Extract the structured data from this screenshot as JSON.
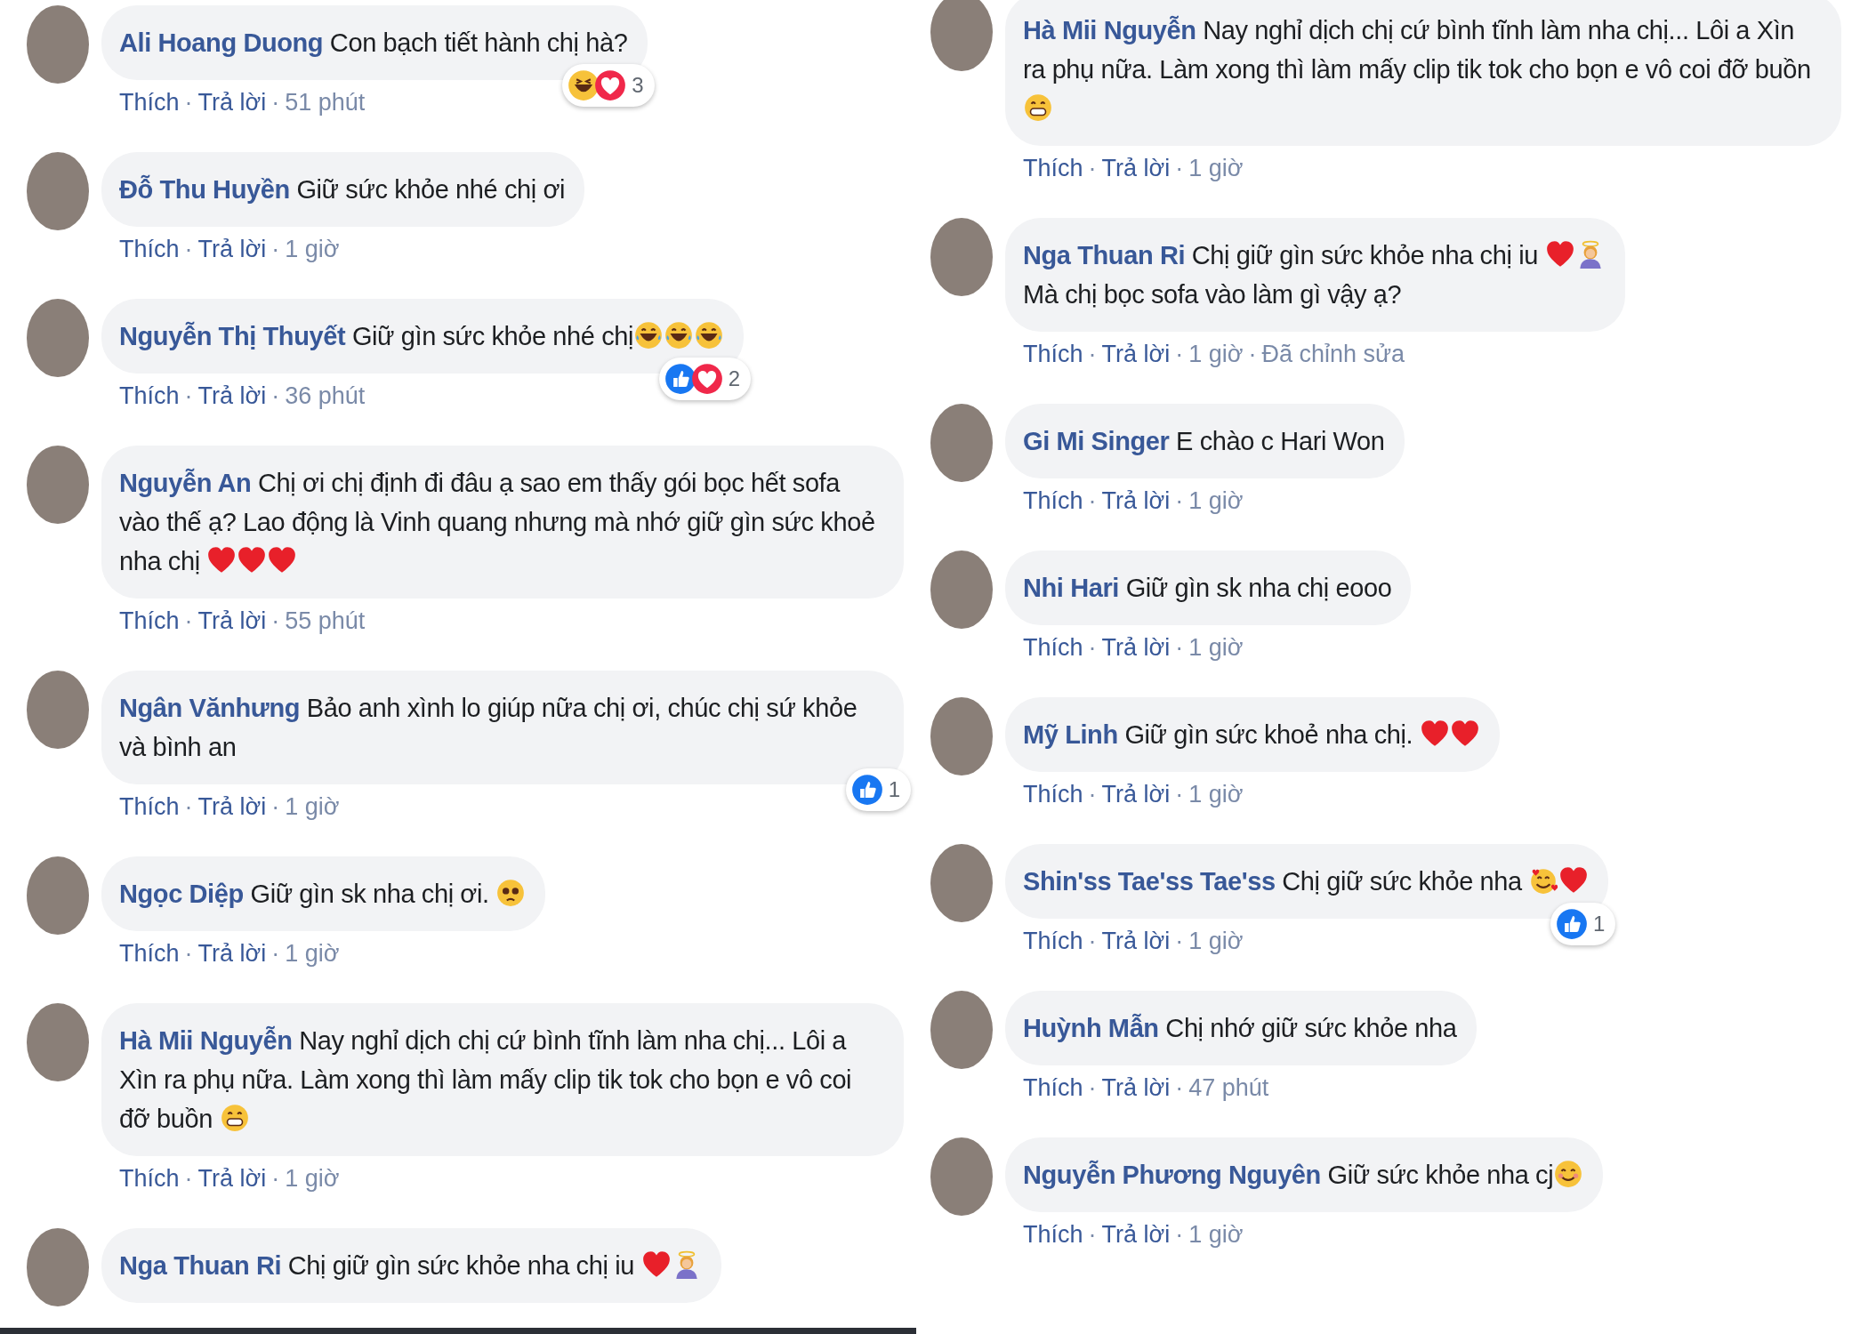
{
  "columns": [
    {
      "comments": [
        {
          "author": "Ali Hoang Duong",
          "body": [
            {
              "kind": "text",
              "text": "Con bạch tiết hành chị hà?"
            }
          ],
          "reactions": {
            "icons": [
              {
                "kind": "haha"
              },
              {
                "kind": "love"
              }
            ],
            "count": "3"
          },
          "actions": [
            {
              "kind": "link",
              "label": "Thích"
            },
            {
              "kind": "separator",
              "label": "·"
            },
            {
              "kind": "link",
              "label": "Trả lời"
            },
            {
              "kind": "separator",
              "label": "·"
            },
            {
              "kind": "time",
              "label": "51 phút"
            }
          ]
        },
        {
          "author": "Đỗ Thu Huyền",
          "body": [
            {
              "kind": "text",
              "text": "Giữ sức khỏe nhé chị ơi"
            }
          ],
          "actions": [
            {
              "kind": "link",
              "label": "Thích"
            },
            {
              "kind": "separator",
              "label": "·"
            },
            {
              "kind": "link",
              "label": "Trả lời"
            },
            {
              "kind": "separator",
              "label": "·"
            },
            {
              "kind": "time",
              "label": "1 giờ"
            }
          ]
        },
        {
          "author": "Nguyễn Thị Thuyết",
          "body": [
            {
              "kind": "text",
              "text": "Giữ gìn sức khỏe nhé chị"
            },
            {
              "kind": "laugh-tears"
            },
            {
              "kind": "laugh-tears"
            },
            {
              "kind": "laugh-tears"
            }
          ],
          "reactions": {
            "icons": [
              {
                "kind": "like"
              },
              {
                "kind": "love"
              }
            ],
            "count": "2"
          },
          "actions": [
            {
              "kind": "link",
              "label": "Thích"
            },
            {
              "kind": "separator",
              "label": "·"
            },
            {
              "kind": "link",
              "label": "Trả lời"
            },
            {
              "kind": "separator",
              "label": "·"
            },
            {
              "kind": "time",
              "label": "36 phút"
            }
          ]
        },
        {
          "author": "Nguyễn An",
          "body": [
            {
              "kind": "text",
              "text": "Chị ơi chị định đi đâu ạ sao em thấy gói bọc hết sofa vào thế ạ? Lao động là Vinh quang nhưng mà nhớ giữ gìn sức khoẻ nha chị "
            },
            {
              "kind": "heart"
            },
            {
              "kind": "heart"
            },
            {
              "kind": "heart"
            }
          ],
          "actions": [
            {
              "kind": "link",
              "label": "Thích"
            },
            {
              "kind": "separator",
              "label": "·"
            },
            {
              "kind": "link",
              "label": "Trả lời"
            },
            {
              "kind": "separator",
              "label": "·"
            },
            {
              "kind": "time",
              "label": "55 phút"
            }
          ]
        },
        {
          "author": "Ngân Vănhưng",
          "body": [
            {
              "kind": "text",
              "text": "Bảo anh xình lo giúp nữa chị ơi, chúc chị sứ khỏe và bình an"
            }
          ],
          "reactions": {
            "icons": [
              {
                "kind": "like"
              }
            ],
            "count": "1"
          },
          "actions": [
            {
              "kind": "link",
              "label": "Thích"
            },
            {
              "kind": "separator",
              "label": "·"
            },
            {
              "kind": "link",
              "label": "Trả lời"
            },
            {
              "kind": "separator",
              "label": "·"
            },
            {
              "kind": "time",
              "label": "1 giờ"
            }
          ]
        },
        {
          "author": "Ngọc Diệp",
          "body": [
            {
              "kind": "text",
              "text": "Giữ gìn sk nha chị ơi. "
            },
            {
              "kind": "pleading"
            }
          ],
          "actions": [
            {
              "kind": "link",
              "label": "Thích"
            },
            {
              "kind": "separator",
              "label": "·"
            },
            {
              "kind": "link",
              "label": "Trả lời"
            },
            {
              "kind": "separator",
              "label": "·"
            },
            {
              "kind": "time",
              "label": "1 giờ"
            }
          ]
        },
        {
          "author": "Hà Mii Nguyễn",
          "body": [
            {
              "kind": "text",
              "text": "Nay nghỉ dịch chị cứ bình tĩnh làm nha chị... Lôi a Xìn ra phụ nữa. Làm xong thì làm mấy clip tik tok cho bọn e vô coi đỡ buồn "
            },
            {
              "kind": "grin"
            }
          ],
          "actions": [
            {
              "kind": "link",
              "label": "Thích"
            },
            {
              "kind": "separator",
              "label": "·"
            },
            {
              "kind": "link",
              "label": "Trả lời"
            },
            {
              "kind": "separator",
              "label": "·"
            },
            {
              "kind": "time",
              "label": "1 giờ"
            }
          ]
        },
        {
          "author": "Nga Thuan Ri",
          "body": [
            {
              "kind": "text",
              "text": "Chị giữ gìn sức khỏe nha chị iu "
            },
            {
              "kind": "heart"
            },
            {
              "kind": "person"
            }
          ]
        }
      ]
    },
    {
      "comments": [
        {
          "author": "Hà Mii Nguyễn",
          "body": [
            {
              "kind": "text",
              "text": "Nay nghỉ dịch chị cứ bình tĩnh làm nha chị... Lôi a Xìn ra phụ nữa. Làm xong thì làm mấy clip tik tok cho bọn e vô coi đỡ buồn "
            },
            {
              "kind": "grin"
            }
          ],
          "actions": [
            {
              "kind": "link",
              "label": "Thích"
            },
            {
              "kind": "separator",
              "label": "·"
            },
            {
              "kind": "link",
              "label": "Trả lời"
            },
            {
              "kind": "separator",
              "label": "·"
            },
            {
              "kind": "time",
              "label": "1 giờ"
            }
          ]
        },
        {
          "author": "Nga Thuan Ri",
          "body": [
            {
              "kind": "text",
              "text": "Chị giữ gìn sức khỏe nha chị iu "
            },
            {
              "kind": "heart"
            },
            {
              "kind": "person"
            },
            {
              "kind": "break"
            },
            {
              "kind": "text",
              "text": "Mà chị bọc sofa vào làm gì vậy ạ?"
            }
          ],
          "actions": [
            {
              "kind": "link",
              "label": "Thích"
            },
            {
              "kind": "separator",
              "label": "·"
            },
            {
              "kind": "link",
              "label": "Trả lời"
            },
            {
              "kind": "separator",
              "label": "·"
            },
            {
              "kind": "time",
              "label": "1 giờ"
            },
            {
              "kind": "separator",
              "label": "·"
            },
            {
              "kind": "time",
              "label": "Đã chỉnh sửa"
            }
          ]
        },
        {
          "author": "Gi Mi Singer",
          "body": [
            {
              "kind": "text",
              "text": "E chào c Hari Won"
            }
          ],
          "actions": [
            {
              "kind": "link",
              "label": "Thích"
            },
            {
              "kind": "separator",
              "label": "·"
            },
            {
              "kind": "link",
              "label": "Trả lời"
            },
            {
              "kind": "separator",
              "label": "·"
            },
            {
              "kind": "time",
              "label": "1 giờ"
            }
          ]
        },
        {
          "author": "Nhi Hari",
          "body": [
            {
              "kind": "text",
              "text": "Giữ gìn sk nha chị eooo"
            }
          ],
          "actions": [
            {
              "kind": "link",
              "label": "Thích"
            },
            {
              "kind": "separator",
              "label": "·"
            },
            {
              "kind": "link",
              "label": "Trả lời"
            },
            {
              "kind": "separator",
              "label": "·"
            },
            {
              "kind": "time",
              "label": "1 giờ"
            }
          ]
        },
        {
          "author": "Mỹ Linh",
          "body": [
            {
              "kind": "text",
              "text": "Giữ gìn sức khoẻ nha chị. "
            },
            {
              "kind": "heart"
            },
            {
              "kind": "heart"
            }
          ],
          "actions": [
            {
              "kind": "link",
              "label": "Thích"
            },
            {
              "kind": "separator",
              "label": "·"
            },
            {
              "kind": "link",
              "label": "Trả lời"
            },
            {
              "kind": "separator",
              "label": "·"
            },
            {
              "kind": "time",
              "label": "1 giờ"
            }
          ]
        },
        {
          "author": "Shin'ss Tae'ss Tae'ss",
          "body": [
            {
              "kind": "text",
              "text": "Chị giữ sức khỏe nha "
            },
            {
              "kind": "hearts-face"
            },
            {
              "kind": "heart"
            }
          ],
          "reactions": {
            "icons": [
              {
                "kind": "like"
              }
            ],
            "count": "1"
          },
          "actions": [
            {
              "kind": "link",
              "label": "Thích"
            },
            {
              "kind": "separator",
              "label": "·"
            },
            {
              "kind": "link",
              "label": "Trả lời"
            },
            {
              "kind": "separator",
              "label": "·"
            },
            {
              "kind": "time",
              "label": "1 giờ"
            }
          ]
        },
        {
          "author": "Huỳnh Mẫn",
          "body": [
            {
              "kind": "text",
              "text": "Chị nhớ giữ sức khỏe nha"
            }
          ],
          "actions": [
            {
              "kind": "link",
              "label": "Thích"
            },
            {
              "kind": "separator",
              "label": "·"
            },
            {
              "kind": "link",
              "label": "Trả lời"
            },
            {
              "kind": "separator",
              "label": "·"
            },
            {
              "kind": "time",
              "label": "47 phút"
            }
          ]
        },
        {
          "author": "Nguyễn Phương Nguyên",
          "body": [
            {
              "kind": "text",
              "text": "Giữ sức khỏe nha cj"
            },
            {
              "kind": "smile"
            }
          ],
          "actions": [
            {
              "kind": "link",
              "label": "Thích"
            },
            {
              "kind": "separator",
              "label": "·"
            },
            {
              "kind": "link",
              "label": "Trả lời"
            },
            {
              "kind": "separator",
              "label": "·"
            },
            {
              "kind": "time",
              "label": "1 giờ"
            }
          ]
        }
      ]
    }
  ]
}
